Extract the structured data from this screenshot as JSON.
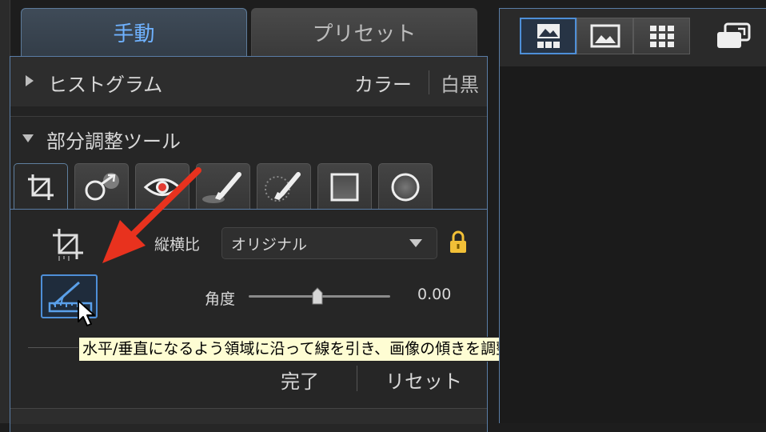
{
  "tabs": {
    "manual": "手動",
    "preset": "プリセット"
  },
  "histogram": {
    "title": "ヒストグラム",
    "mode_color": "カラー",
    "mode_mono": "白黒"
  },
  "local_adjust": {
    "title": "部分調整ツール",
    "tools": [
      "crop-tool-icon",
      "color-point-icon",
      "red-eye-icon",
      "brush-icon",
      "selection-brush-icon",
      "rectangle-icon",
      "circle-icon"
    ]
  },
  "crop": {
    "aspect_label": "縦横比",
    "aspect_value": "オリジナル",
    "angle_label": "角度",
    "angle_value": "0.00",
    "tooltip": "水平/垂直になるよう領域に沿って線を引き、画像の傾きを調整します",
    "done": "完了",
    "reset": "リセット"
  },
  "colors": {
    "accent": "#4e8fd8",
    "active_tab_text": "#6fb2ff",
    "annotation_arrow": "#e8321e",
    "lock": "#f2c037"
  }
}
